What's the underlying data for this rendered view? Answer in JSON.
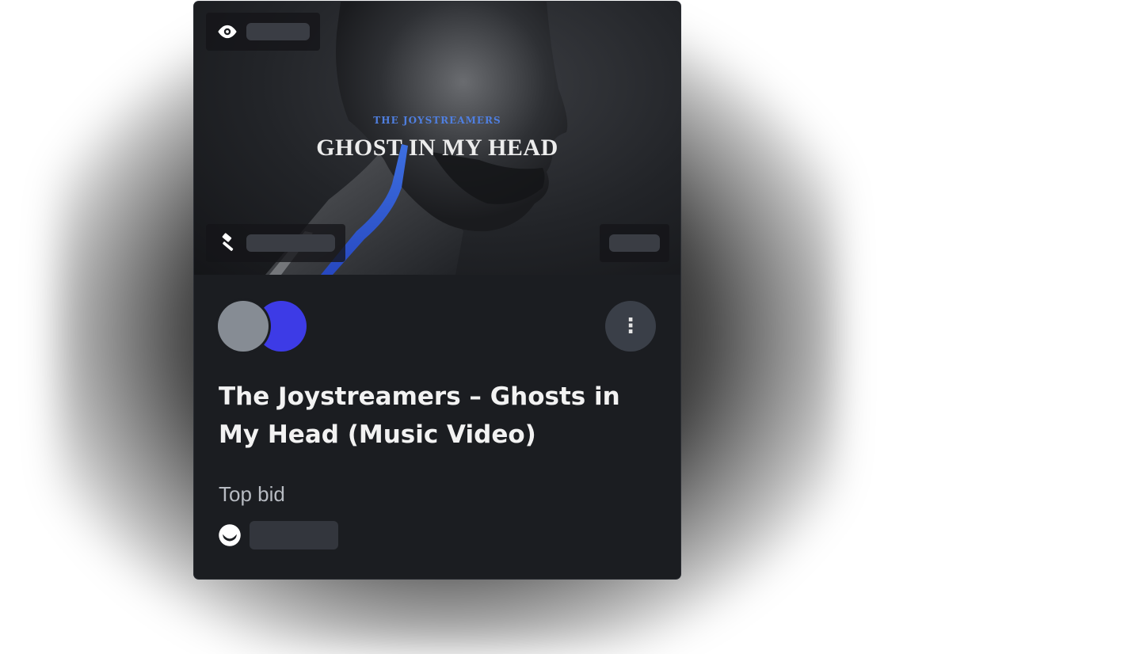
{
  "card": {
    "cover": {
      "overline": "THE JOYSTREAMERS",
      "headline": "GHOST IN MY HEAD",
      "icons": {
        "views": "eye-icon",
        "auction": "gavel-icon"
      }
    },
    "more_button_label": "⋮",
    "title": "The Joystreamers – Ghosts in My Head (Music Video)",
    "bid_label": "Top bid",
    "bid_icon": "joystream-token-icon"
  },
  "colors": {
    "card_background": "#1b1d21",
    "accent_blue": "#3d3be6",
    "avatar_gray": "#868c94",
    "overline_blue": "#4f7fe0"
  }
}
